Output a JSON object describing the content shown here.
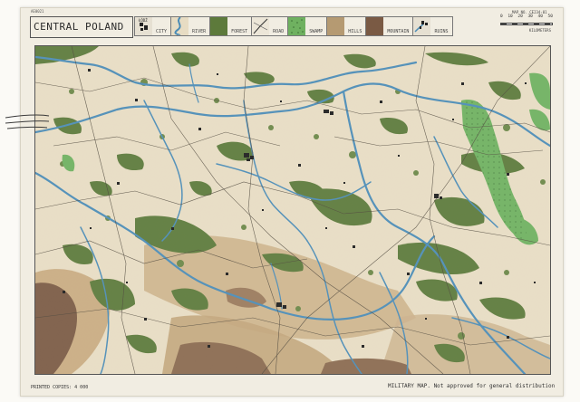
{
  "sheet": {
    "serial": "AE0021",
    "title": "CENTRAL POLAND",
    "sheet_no": "MAP NO. CE234-01",
    "printed_copies": "PRINTED COPIES: 4 000",
    "disclaimer": "MILITARY MAP. Not approved for general distribution"
  },
  "legend": [
    {
      "label": "CITY",
      "icon": "city-icon",
      "color": "#e6e0d2"
    },
    {
      "label": "RIVER",
      "icon": "river-icon",
      "color": "#5b94b8"
    },
    {
      "label": "FOREST",
      "icon": "forest-icon",
      "color": "#5d7a3b"
    },
    {
      "label": "ROAD",
      "icon": "road-icon",
      "color": "#ece6d8"
    },
    {
      "label": "SWAMP",
      "icon": "swamp-icon",
      "color": "#6fb160"
    },
    {
      "label": "HILLS",
      "icon": "hills-icon",
      "color": "#b59a72"
    },
    {
      "label": "MOUNTAIN",
      "icon": "mountain-icon",
      "color": "#7a5a44"
    },
    {
      "label": "RUINS",
      "icon": "ruins-icon",
      "color": "#e6e0d2"
    }
  ],
  "scale": {
    "ticks": [
      "0",
      "10",
      "20",
      "30",
      "40",
      "50"
    ],
    "unit": "KILOMETERS"
  },
  "colors": {
    "paper": "#f1ede2",
    "land": "#e7dcc3",
    "river": "#4b8cb6",
    "forest": "#5d7a3b",
    "swamp": "#6fb160",
    "hills": "#c1a47a",
    "mountain": "#7b5b45"
  }
}
